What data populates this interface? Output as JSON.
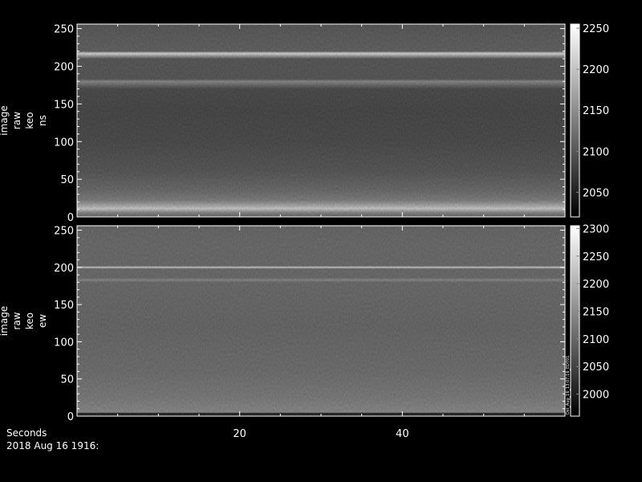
{
  "footer": {
    "xaxis_label": "Seconds",
    "timestamp": "2018 Aug 16 1916:"
  },
  "side_annotation": "Dst_Aug_16_13:07:16_EDT01",
  "colors": {
    "background": "#000000",
    "foreground": "#ffffff"
  },
  "chart_data": [
    {
      "type": "heatmap",
      "ylabel_lines": [
        "image",
        "raw",
        "keo",
        "ns"
      ],
      "ylim": [
        0,
        256
      ],
      "yticks": [
        0,
        50,
        100,
        150,
        200,
        250
      ],
      "xlim": [
        0,
        60
      ],
      "xticks": [
        20,
        40
      ],
      "colorbar": {
        "range": [
          2020,
          2255
        ],
        "ticks": [
          2050,
          2100,
          2150,
          2200,
          2250
        ]
      },
      "profile": [
        [
          0,
          0.35
        ],
        [
          6,
          0.55
        ],
        [
          11,
          0.88
        ],
        [
          15,
          0.72
        ],
        [
          22,
          0.5
        ],
        [
          35,
          0.4
        ],
        [
          60,
          0.3
        ],
        [
          100,
          0.24
        ],
        [
          140,
          0.22
        ],
        [
          170,
          0.24
        ],
        [
          180,
          0.55
        ],
        [
          183,
          0.3
        ],
        [
          210,
          0.3
        ],
        [
          217,
          0.95
        ],
        [
          220,
          0.35
        ],
        [
          240,
          0.33
        ],
        [
          256,
          0.3
        ]
      ]
    },
    {
      "type": "heatmap",
      "ylabel_lines": [
        "image",
        "raw",
        "keo",
        "ew"
      ],
      "ylim": [
        0,
        256
      ],
      "yticks": [
        0,
        50,
        100,
        150,
        200,
        250
      ],
      "xlim": [
        0,
        60
      ],
      "xticks": [
        20,
        40
      ],
      "colorbar": {
        "range": [
          1960,
          2305
        ],
        "ticks": [
          2000,
          2050,
          2100,
          2150,
          2200,
          2250,
          2300
        ]
      },
      "profile": [
        [
          0,
          0.05
        ],
        [
          4,
          0.05
        ],
        [
          5,
          0.55
        ],
        [
          25,
          0.48
        ],
        [
          60,
          0.42
        ],
        [
          120,
          0.38
        ],
        [
          180,
          0.4
        ],
        [
          183,
          0.55
        ],
        [
          186,
          0.4
        ],
        [
          198,
          0.4
        ],
        [
          200,
          0.9
        ],
        [
          202,
          0.4
        ],
        [
          230,
          0.4
        ],
        [
          256,
          0.38
        ]
      ]
    }
  ]
}
